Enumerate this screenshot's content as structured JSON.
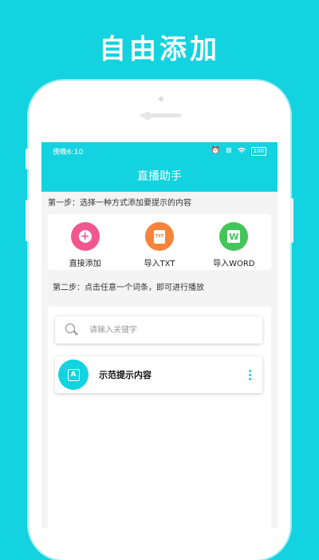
{
  "headline": "自由添加",
  "status_bar": {
    "time": "傍晚6:10",
    "battery": "100"
  },
  "app": {
    "title": "直播助手"
  },
  "step1": {
    "text": "第一步：选择一种方式添加要提示的内容",
    "actions": [
      {
        "label": "直接添加",
        "icon": "plus-circle-icon",
        "color": "#f0588d"
      },
      {
        "label": "导入TXT",
        "icon": "txt-file-icon",
        "color": "#f7843b",
        "glyph": "TXT"
      },
      {
        "label": "导入WORD",
        "icon": "word-icon",
        "color": "#43c55a",
        "glyph": "W"
      }
    ]
  },
  "step2": {
    "text": "第二步：点击任意一个词条，即可进行播放"
  },
  "search": {
    "placeholder": "请输入关键字"
  },
  "items": [
    {
      "title": "示范提示内容",
      "icon_letter": "A"
    }
  ],
  "colors": {
    "accent": "#12d3df",
    "pink": "#f0588d",
    "orange": "#f7843b",
    "green": "#43c55a"
  }
}
